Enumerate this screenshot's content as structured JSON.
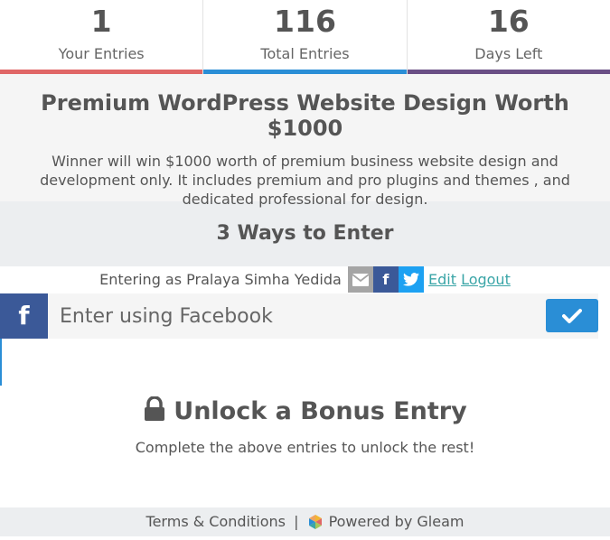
{
  "stats": [
    {
      "number": "1",
      "label": "Your Entries",
      "color": "#e06666"
    },
    {
      "number": "116",
      "label": "Total Entries",
      "color": "#2a8ed6"
    },
    {
      "number": "16",
      "label": "Days Left",
      "color": "#6a4f85"
    }
  ],
  "prize": {
    "title": "Premium WordPress Website Design Worth $1000",
    "description": "Winner will win $1000 worth of premium business website design and development only. It includes premium and pro plugins and themes , and dedicated professional for design."
  },
  "ways": {
    "heading": "3 Ways to Enter"
  },
  "entering": {
    "prefix": "Entering as Pralaya Simha Yedida",
    "edit_label": "Edit",
    "logout_label": "Logout",
    "icons": [
      "mail-icon",
      "facebook-icon",
      "twitter-icon"
    ]
  },
  "entry": {
    "label": "Enter using Facebook",
    "icon": "facebook-icon",
    "check_icon": "checkmark-icon"
  },
  "bonus": {
    "title": "Unlock a Bonus Entry",
    "subtitle": "Complete the above entries to unlock the rest!"
  },
  "footer": {
    "terms_label": "Terms & Conditions",
    "separator": "|",
    "powered_label": "Powered by Gleam"
  }
}
